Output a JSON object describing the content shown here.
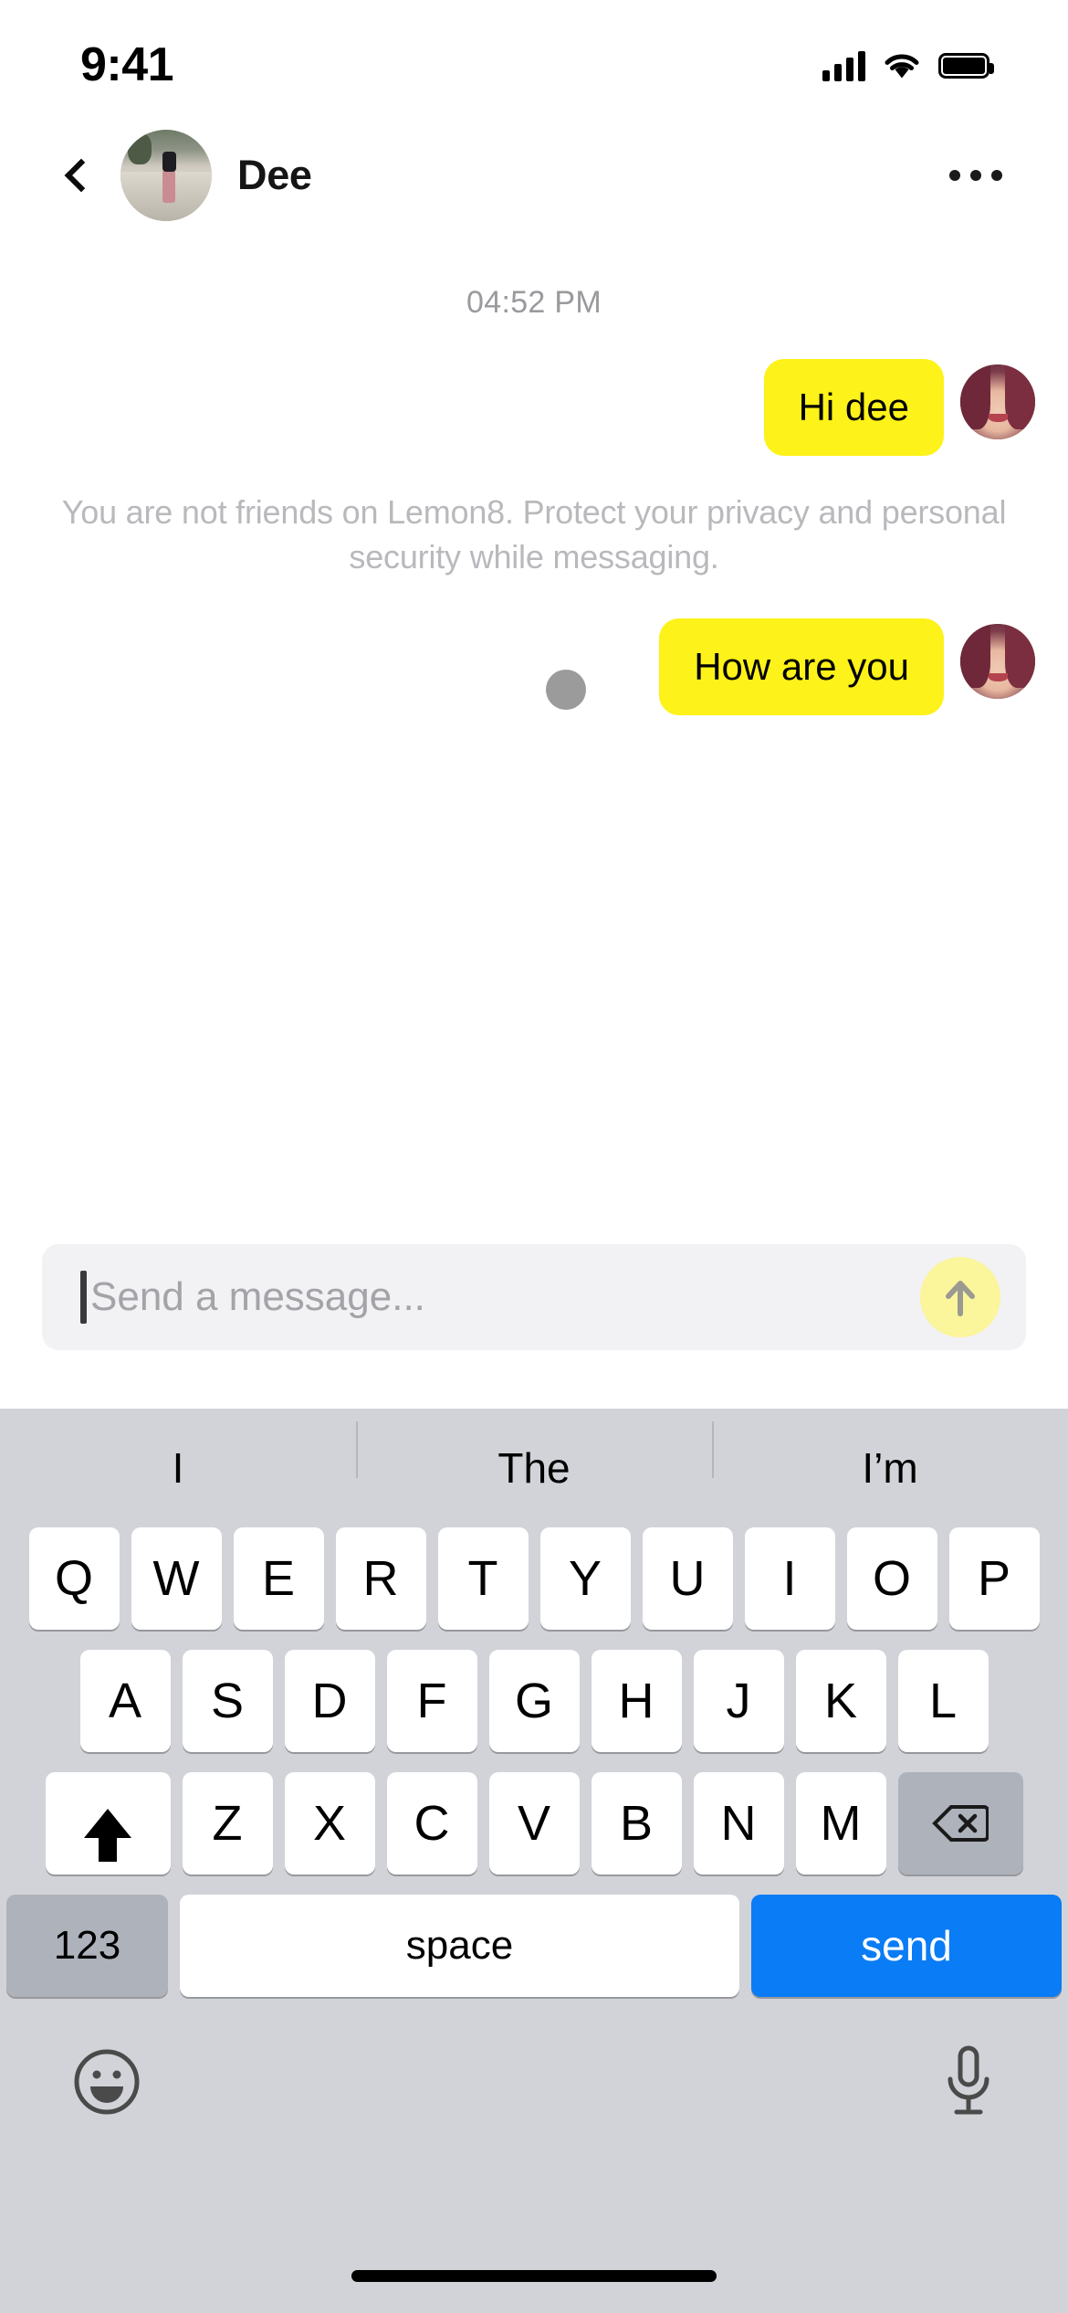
{
  "status_bar": {
    "time": "9:41",
    "cellular_icon": "signal-bars-icon",
    "wifi_icon": "wifi-icon",
    "battery_icon": "battery-full-icon"
  },
  "header": {
    "back_icon": "back-chevron-icon",
    "avatar_icon": "peer-avatar",
    "title": "Dee",
    "more_icon": "more-options-icon"
  },
  "conversation": {
    "timestamp": "04:52 PM",
    "privacy_notice": "You are not friends on Lemon8. Protect your privacy and personal security while messaging.",
    "bubble_color": "#fdf219",
    "messages": [
      {
        "text": "Hi dee",
        "side": "outgoing",
        "avatar": "sender-avatar"
      },
      {
        "text": "How are you",
        "side": "outgoing",
        "avatar": "sender-avatar",
        "status": "sending"
      }
    ]
  },
  "composer": {
    "placeholder": "Send a message...",
    "value": "",
    "send_icon": "send-arrow-up-icon",
    "send_button_color": "#fbf59b"
  },
  "keyboard": {
    "suggestions": [
      "I",
      "The",
      "I’m"
    ],
    "row1": [
      "Q",
      "W",
      "E",
      "R",
      "T",
      "Y",
      "U",
      "I",
      "O",
      "P"
    ],
    "row2": [
      "A",
      "S",
      "D",
      "F",
      "G",
      "H",
      "J",
      "K",
      "L"
    ],
    "row3": [
      "Z",
      "X",
      "C",
      "V",
      "B",
      "N",
      "M"
    ],
    "shift_icon": "shift-up-arrow-icon",
    "delete_icon": "backspace-delete-icon",
    "numeric_label": "123",
    "space_label": "space",
    "send_label": "send",
    "send_key_color": "#0a7cf5",
    "emoji_icon": "emoji-smiley-icon",
    "dictation_icon": "microphone-icon"
  }
}
